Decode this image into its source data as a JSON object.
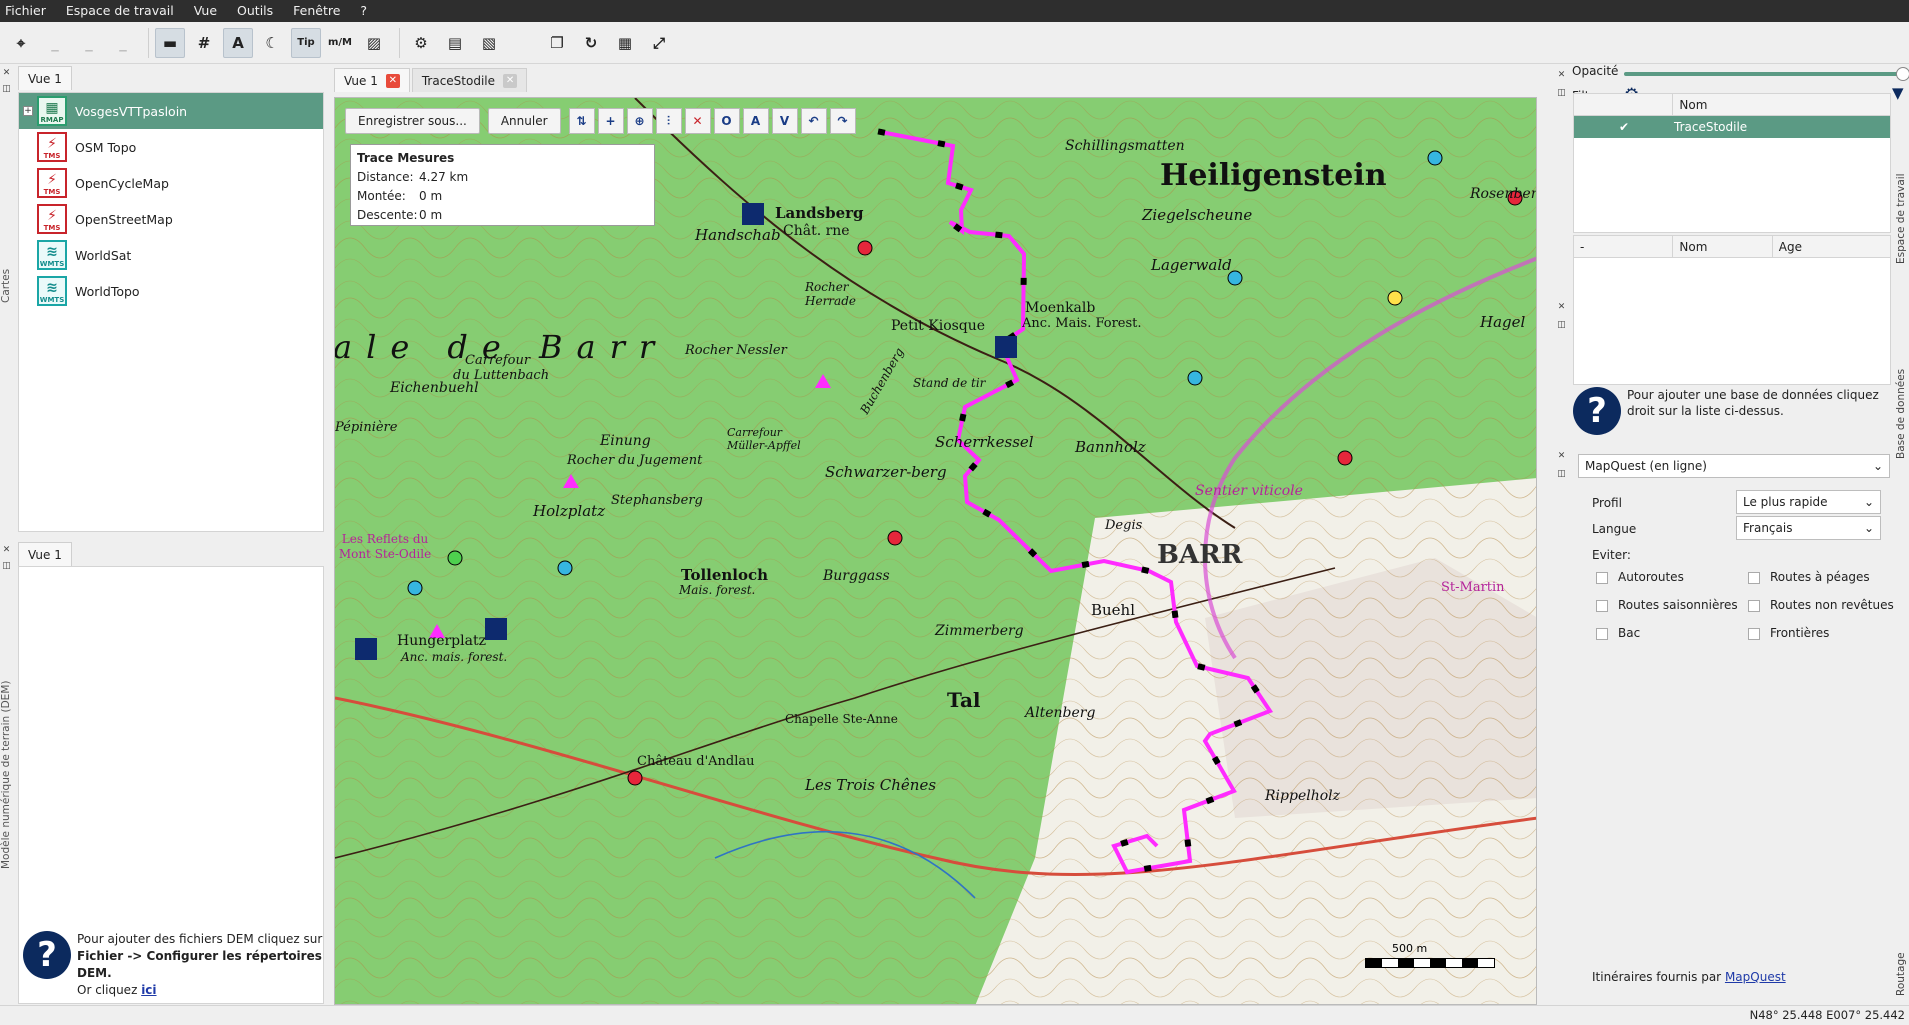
{
  "menu": [
    "Fichier",
    "Espace de travail",
    "Vue",
    "Outils",
    "Fenêtre",
    "?"
  ],
  "toolbar": {
    "tools": [
      {
        "icon": "app-logo-icon",
        "glyph": "⌖",
        "selected": false
      },
      {
        "icon": "blank-1",
        "glyph": "_",
        "selected": false,
        "dim": true
      },
      {
        "icon": "blank-2",
        "glyph": "_",
        "selected": false,
        "dim": true
      },
      {
        "icon": "blank-3",
        "glyph": "_",
        "selected": false,
        "dim": true
      },
      {
        "icon": "scale-ruler-icon",
        "glyph": "▬",
        "selected": true
      },
      {
        "icon": "grid-icon",
        "glyph": "#",
        "selected": false
      },
      {
        "icon": "north-arrow-icon",
        "glyph": "A",
        "selected": true
      },
      {
        "icon": "night-mode-icon",
        "glyph": "☾",
        "selected": false
      },
      {
        "icon": "tip-icon",
        "glyph": "Tip",
        "selected": true
      },
      {
        "icon": "min-max-icon",
        "glyph": "m/M",
        "selected": false
      },
      {
        "icon": "picture-icon",
        "glyph": "▨",
        "selected": false
      },
      {
        "icon": "settings-gear-icon",
        "glyph": "⚙",
        "selected": false
      },
      {
        "icon": "map-window-icon",
        "glyph": "▤",
        "selected": false
      },
      {
        "icon": "image-window-icon",
        "glyph": "▧",
        "selected": false
      },
      {
        "icon": "blank-4",
        "glyph": "",
        "selected": false,
        "dim": true
      },
      {
        "icon": "copy-icon",
        "glyph": "❐",
        "selected": false
      },
      {
        "icon": "route-icon",
        "glyph": "↻",
        "selected": false
      },
      {
        "icon": "layers-icon",
        "glyph": "▦",
        "selected": false
      },
      {
        "icon": "fullscreen-icon",
        "glyph": "⤢",
        "selected": false
      }
    ]
  },
  "left": {
    "cartes_tab": "Cartes",
    "dem_tab": "Modèle numérique de terrain (DEM)",
    "top_tab": "Vue 1",
    "layers": [
      {
        "name": "VosgesVTTpasloin",
        "type": "RMAP",
        "selected": true,
        "expandable": true
      },
      {
        "name": "OSM Topo",
        "type": "TMS"
      },
      {
        "name": "OpenCycleMap",
        "type": "TMS"
      },
      {
        "name": "OpenStreetMap",
        "type": "TMS"
      },
      {
        "name": "WorldSat",
        "type": "WMTS"
      },
      {
        "name": "WorldTopo",
        "type": "WMTS"
      }
    ],
    "bottom_tab": "Vue 1",
    "dem_info": {
      "line1": "Pour ajouter des fichiers DEM cliquez sur",
      "menu_path": "Fichier -> Configurer les répertoires DEM",
      "line3_pre": "Or cliquez ",
      "link": "ici"
    }
  },
  "map": {
    "tabs": [
      {
        "label": "Vue 1",
        "active": true
      },
      {
        "label": "TraceStodile",
        "active": false
      }
    ],
    "buttons": {
      "save": "Enregistrer sous...",
      "cancel": "Annuler"
    },
    "edit_icons": [
      "move-points-icon",
      "add-point-icon",
      "insert-point-icon",
      "split-icon",
      "delete-point-icon",
      "O",
      "A",
      "V",
      "undo-icon",
      "redo-icon"
    ],
    "trace": {
      "title": "Trace Mesures",
      "distance_label": "Distance:",
      "distance": "4.27 km",
      "climb_label": "Montée:",
      "climb": "0 m",
      "descent_label": "Descente:",
      "descent": "0 m"
    },
    "labels": [
      "Heiligenstein",
      "Landsberg",
      "Chât. rne",
      "Handschab",
      "ale de Barr",
      "Carrefour",
      "du Luttenbach",
      "Eichenbuehl",
      "Rocher Nessler",
      "Petit Kiosque",
      "Moenkalb",
      "Anc. Mais. Forest.",
      "Lagerwald",
      "Ziegelscheune",
      "Schillingsmatten",
      "Rosenberg",
      "Hagel",
      "Bannholz",
      "Schwarzer-berg",
      "Scherrkessel",
      "Stand de tir",
      "Buchenberg",
      "Rocher du Jugement",
      "Einung",
      "Holzplatz",
      "Stephansberg",
      "Tollenloch",
      "Mais. forest.",
      "Burggass",
      "Zimmerberg",
      "Buehl",
      "BARR",
      "Hungerplatz",
      "Anc. mais. forest.",
      "Tal",
      "Altenberg",
      "Chapelle Ste-Anne",
      "Château d'Andlau",
      "Les Trois Chênes",
      "Rippelholz",
      "Les Reflets du Mont Ste-Odile",
      "Sentier viticole",
      "Carrefour Müller-Apffel",
      "Pépinière",
      "Rocher Herrade",
      "St-Martin",
      "Degis"
    ],
    "scale_label": "500 m"
  },
  "right": {
    "opacity_label": "Opacité",
    "opacity": 1.0,
    "filter_label": "Filtre",
    "workspace_tab": "Espace de travail",
    "database_tab": "Base de données",
    "routing_tab": "Routage",
    "workspace_table": {
      "columns": [
        "",
        "Nom"
      ],
      "rows": [
        {
          "checked": true,
          "name": "TraceStodile"
        }
      ]
    },
    "db_table": {
      "columns": [
        "-",
        "Nom",
        "Age"
      ]
    },
    "db_info": "Pour ajouter une base de données cliquez droit sur la liste ci-dessus.",
    "routing": {
      "provider": "MapQuest (en ligne)",
      "profile_label": "Profil",
      "profile": "Le plus rapide",
      "language_label": "Langue",
      "language": "Français",
      "avoid_label": "Eviter:",
      "options": [
        "Autoroutes",
        "Routes à péages",
        "Routes saisonnières",
        "Routes non revêtues",
        "Bac",
        "Frontières"
      ],
      "credit": "Itinéraires fournis par ",
      "credit_link": "MapQuest"
    }
  },
  "status": {
    "coords": "N48° 25.448 E007° 25.442"
  },
  "colors": {
    "accent": "#5b9a84",
    "track": "#ff00ff",
    "map_green": "#7fc96b"
  }
}
